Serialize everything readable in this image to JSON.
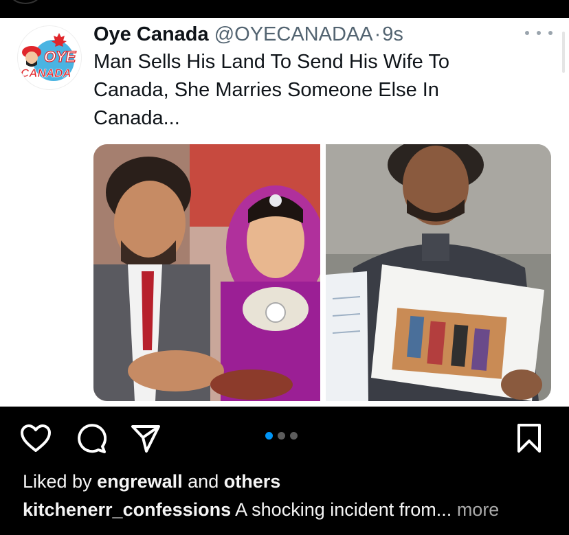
{
  "tweet": {
    "display_name": "Oye Canada",
    "handle": "@OYECANADAA",
    "separator": "·",
    "time": "9s",
    "avatar_text_top": "OYE",
    "avatar_text_bottom": "CANADA",
    "text_lines": [
      "Man Sells His Land To Send His Wife To",
      "Canada, She Marries Someone Else In",
      "Canada..."
    ]
  },
  "post": {
    "carousel": {
      "count": 3,
      "active_index": 0
    },
    "likes": {
      "prefix": "Liked by",
      "user": "engrewall",
      "middle": "and",
      "suffix": "others"
    },
    "caption": {
      "username": "kitchenerr_confessions",
      "text": "A shocking incident from...",
      "more": "more"
    }
  },
  "icons": {
    "like": "heart-icon",
    "comment": "comment-icon",
    "share": "send-icon",
    "save": "bookmark-icon",
    "overflow": "more-horizontal-icon"
  },
  "colors": {
    "background": "#000000",
    "card": "#ffffff",
    "carousel_active": "#0095f6",
    "brand_red": "#e0262b",
    "brand_blue": "#2aa7dd"
  }
}
